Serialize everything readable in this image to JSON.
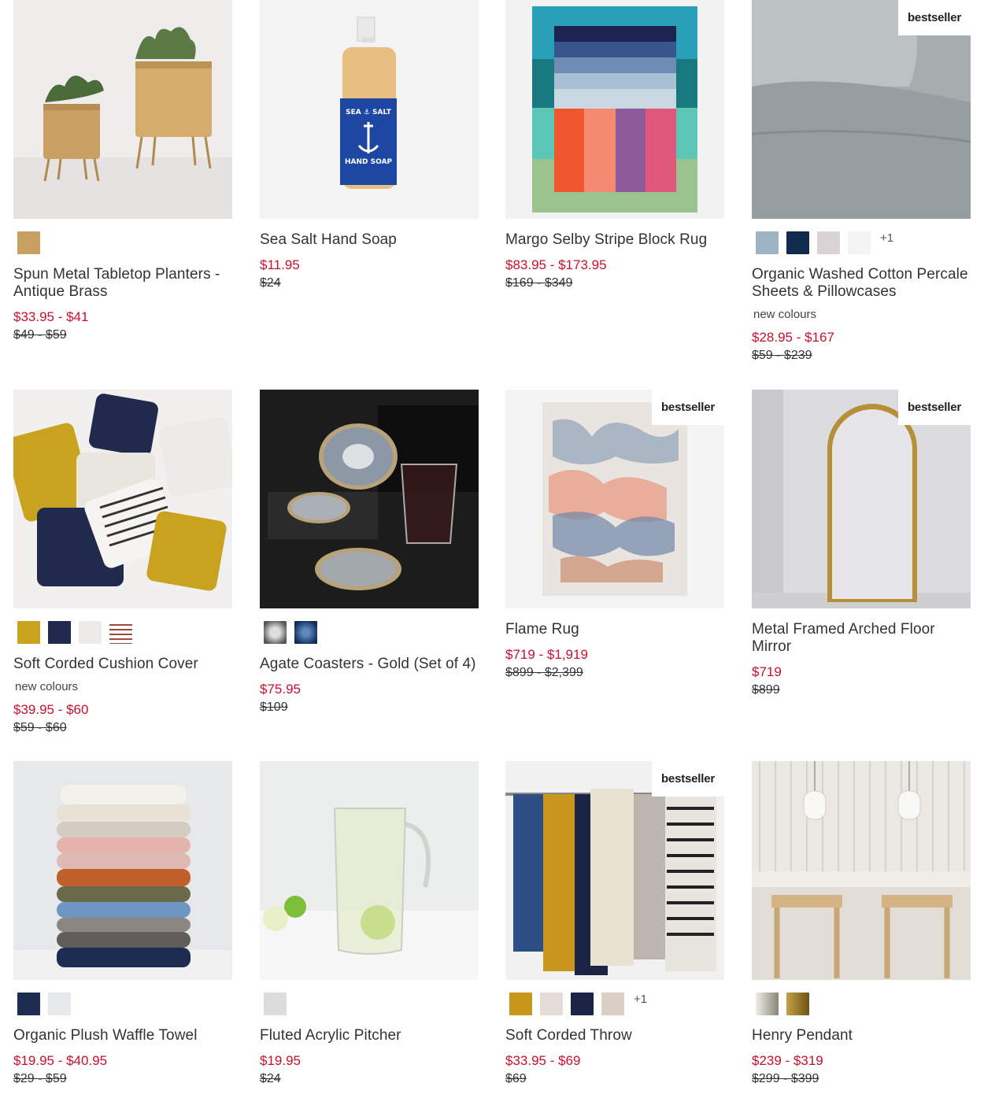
{
  "products": [
    {
      "name": "Spun Metal Tabletop Planters - Antique Brass",
      "badge": "",
      "swatches": [
        "#c9a064"
      ],
      "more": "",
      "note": "",
      "sale": "$33.95 - $41",
      "original": "$49 - $59"
    },
    {
      "name": "Sea Salt Hand Soap",
      "badge": "",
      "swatches": [],
      "more": "",
      "note": "",
      "sale": "$11.95",
      "original": "$24"
    },
    {
      "name": "Margo Selby Stripe Block Rug",
      "badge": "",
      "swatches": [],
      "more": "",
      "note": "",
      "sale": "$83.95 - $173.95",
      "original": "$169 - $349"
    },
    {
      "name": "Organic Washed Cotton Percale Sheets & Pillowcases",
      "badge": "bestseller",
      "swatches": [
        "#9fb4c2",
        "#102a4c",
        "#d9d3d5",
        "#f4f4f4"
      ],
      "more": "+1",
      "note": "new colours",
      "sale": "$28.95 - $167",
      "original": "$59 - $239"
    },
    {
      "name": "Soft Corded Cushion Cover",
      "badge": "",
      "swatches": [
        "#c9a21f",
        "#1f2a4d",
        "#ecebe7",
        "#b98a86"
      ],
      "more": "",
      "note": "new colours",
      "sale": "$39.95 - $60",
      "original": "$59 - $60"
    },
    {
      "name": "Agate Coasters - Gold (Set of 4)",
      "badge": "",
      "swatches": [
        "#8a8f96",
        "#1d4a7a"
      ],
      "more": "",
      "note": "",
      "sale": "$75.95",
      "original": "$109"
    },
    {
      "name": "Flame Rug",
      "badge": "bestseller",
      "swatches": [],
      "more": "",
      "note": "",
      "sale": "$719 - $1,919",
      "original": "$899 - $2,399"
    },
    {
      "name": "Metal Framed Arched Floor Mirror",
      "badge": "bestseller",
      "swatches": [],
      "more": "",
      "note": "",
      "sale": "$719",
      "original": "$899"
    },
    {
      "name": "Organic Plush Waffle Towel",
      "badge": "",
      "swatches": [
        "#1d2d52",
        "#e6e8ec"
      ],
      "more": "",
      "note": "",
      "sale": "$19.95 - $40.95",
      "original": "$29 - $59"
    },
    {
      "name": "Fluted Acrylic Pitcher",
      "badge": "",
      "swatches": [
        "#dcdcdc"
      ],
      "more": "",
      "note": "",
      "sale": "$19.95",
      "original": "$24"
    },
    {
      "name": "Soft Corded Throw",
      "badge": "bestseller",
      "swatches": [
        "#c9961e",
        "#e3dcd8",
        "#1b2444",
        "#d9cfc2"
      ],
      "more": "+1",
      "note": "",
      "sale": "$33.95 - $69",
      "original": "$69"
    },
    {
      "name": "Henry Pendant",
      "badge": "",
      "swatches": [
        "#c8c4ba",
        "#9a7a2a"
      ],
      "more": "",
      "note": "",
      "sale": "$239 - $319",
      "original": "$299 - $399"
    }
  ]
}
